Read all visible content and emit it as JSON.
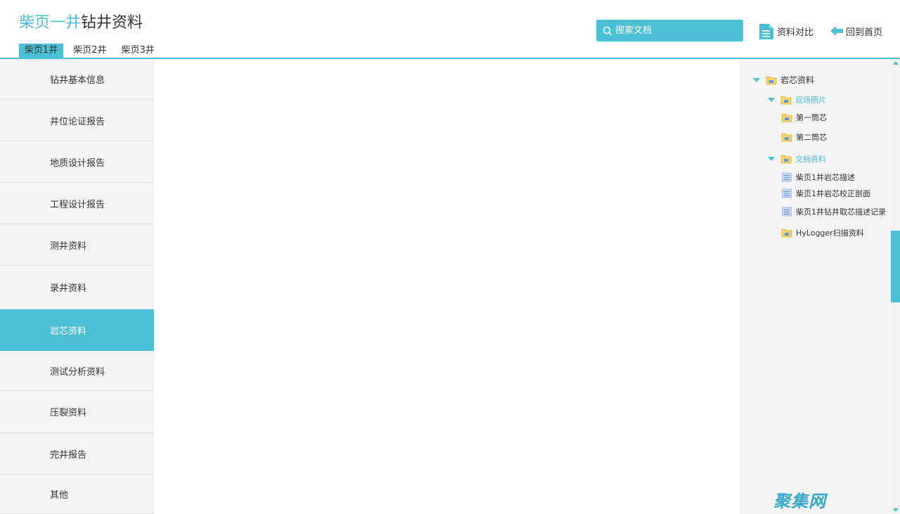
{
  "header": {
    "title_accent": "柴页一井",
    "title_rest": "钻井资料",
    "well_tabs": [
      "柴页1井",
      "柴页2井",
      "柴页3井"
    ],
    "search_placeholder": "搜索文档",
    "compare_label": "资料对比",
    "home_label": "回到首页"
  },
  "sidebar": {
    "items": [
      "钻井基本信息",
      "井位论证报告",
      "地质设计报告",
      "工程设计报告",
      "测井资料",
      "录井资料",
      "岩芯资料",
      "测试分析资料",
      "压裂资料",
      "完井报告",
      "其他"
    ],
    "active": "岩芯资料"
  },
  "tree": {
    "root": "岩芯资料",
    "photos": "现场照片",
    "core1": "第一筒芯",
    "core2": "第二筒芯",
    "docs": "文档资料",
    "doc1": "柴页1井岩芯描述",
    "doc2": "柴页1井岩芯校正剖面",
    "doc3": "柴页1井钻井取芯描述记录",
    "hylogger": "HyLogger扫描资料"
  },
  "watermark": "聚集网",
  "colors": {
    "accent": "#4bbfd3",
    "sidebar_bg": "#f4f4f4",
    "folder": "#f5d36b",
    "doc_icon": "#9fb4e0"
  }
}
